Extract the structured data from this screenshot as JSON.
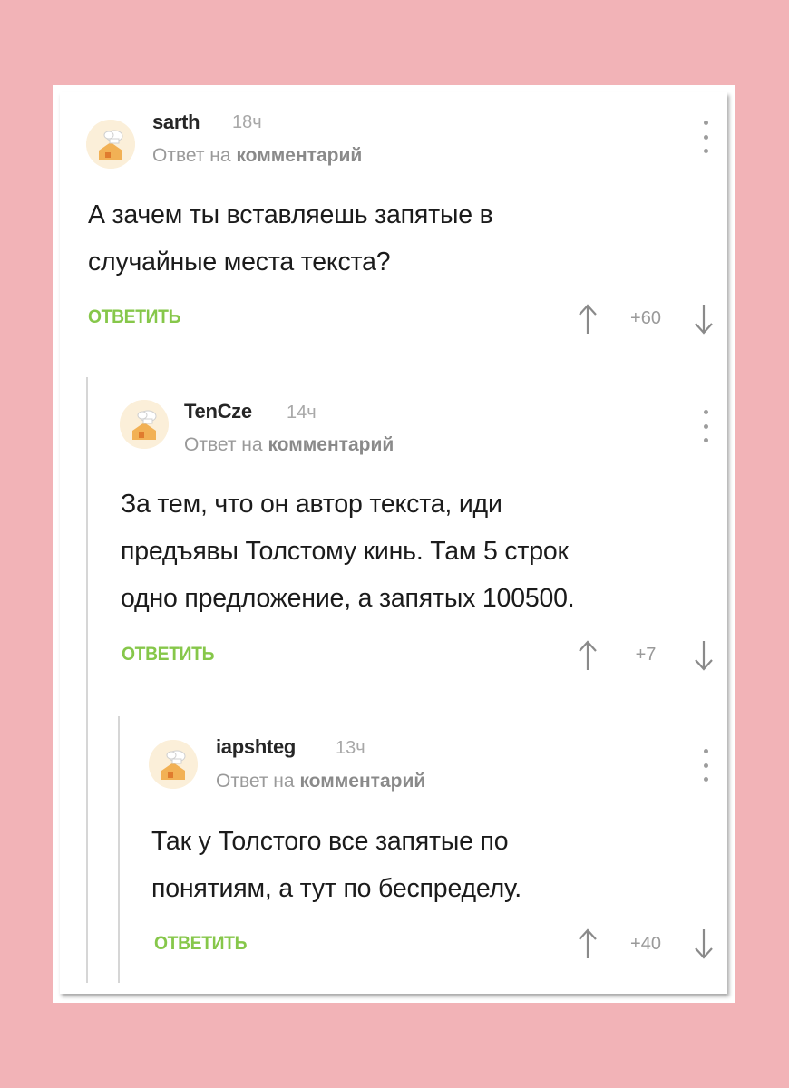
{
  "comments": [
    {
      "username": "sarth",
      "time": "18ч",
      "reply_prefix": "Ответ на",
      "reply_target": "комментарий",
      "text_lines": [
        "А зачем ты вставляешь запятые в",
        "случайные места текста?"
      ],
      "reply_label": "ОТВЕТИТЬ",
      "score": "+60"
    },
    {
      "username": "TenCze",
      "time": "14ч",
      "reply_prefix": "Ответ на",
      "reply_target": "комментарий",
      "text_lines": [
        "За тем, что он автор текста, иди",
        "предъявы Толстому кинь. Там 5 строк",
        "одно предложение, а запятых 100500."
      ],
      "reply_label": "ОТВЕТИТЬ",
      "score": "+7"
    },
    {
      "username": "iapshteg",
      "time": "13ч",
      "reply_prefix": "Ответ на",
      "reply_target": "комментарий",
      "text_lines": [
        "Так у Толстого все запятые по",
        "понятиям, а тут по беспределу."
      ],
      "reply_label": "ОТВЕТИТЬ",
      "score": "+40"
    }
  ],
  "colors": {
    "background": "#f2b3b7",
    "reply_button": "#86c74a",
    "muted_text": "#9a9a9a",
    "thread_line": "#d6d6d6"
  },
  "icons": {
    "avatar": "chef-hat-house-avatar-icon",
    "menu": "vertical-dots-icon",
    "upvote": "arrow-up-icon",
    "downvote": "arrow-down-icon"
  }
}
